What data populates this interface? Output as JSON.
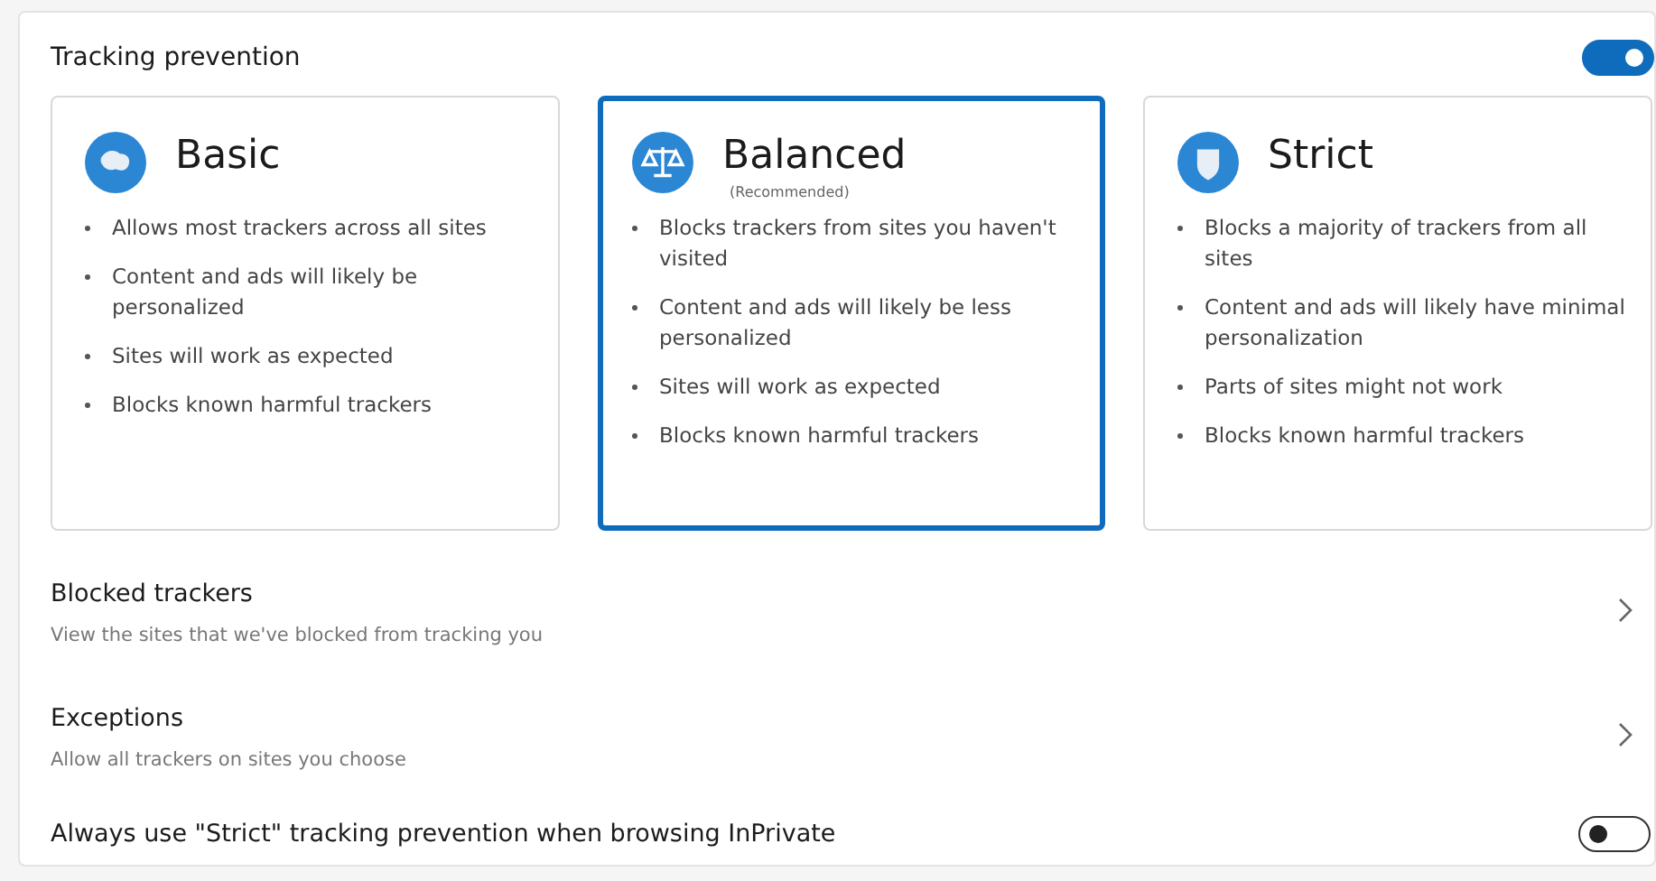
{
  "section": {
    "title": "Tracking prevention",
    "on": true
  },
  "cards": [
    {
      "title": "Basic",
      "selected": false,
      "bullets": [
        "Allows most trackers across all sites",
        "Content and ads will likely be personalized",
        "Sites will work as expected",
        "Blocks known harmful trackers"
      ]
    },
    {
      "title": "Balanced",
      "subtitle": "(Recommended)",
      "selected": true,
      "bullets": [
        "Blocks trackers from sites you haven't visited",
        "Content and ads will likely be less personalized",
        "Sites will work as expected",
        "Blocks known harmful trackers"
      ]
    },
    {
      "title": "Strict",
      "selected": false,
      "bullets": [
        "Blocks a majority of trackers from all sites",
        "Content and ads will likely have minimal personalization",
        "Parts of sites might not work",
        "Blocks known harmful trackers"
      ]
    }
  ],
  "links": [
    {
      "title": "Blocked trackers",
      "description": "View the sites that we've blocked from tracking you"
    },
    {
      "title": "Exceptions",
      "description": "Allow all trackers on sites you choose"
    }
  ],
  "inprivate": {
    "label": "Always use \"Strict\" tracking prevention when browsing InPrivate",
    "on": false
  }
}
